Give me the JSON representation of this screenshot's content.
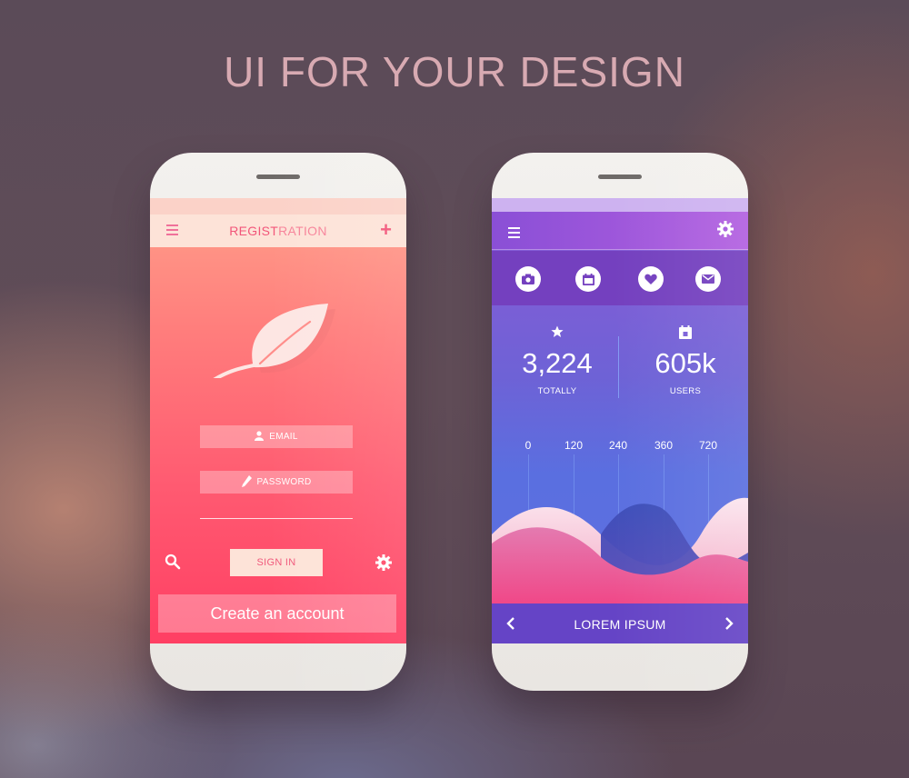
{
  "headline": "UI FOR YOUR DESIGN",
  "colors": {
    "left_accent": "#f2567a",
    "left_gradient_top": "#ff9f8a",
    "left_gradient_bottom": "#ff3f63",
    "right_header": "#8a4fd6",
    "right_footer": "#6544c6"
  },
  "left_phone": {
    "header": {
      "title_highlight": "REGIST",
      "title_rest": "RATION",
      "menu_icon": "hamburger-icon",
      "add_icon": "plus-icon",
      "add_label": "+"
    },
    "logo_icon": "leaf-icon",
    "email_label": "EMAIL",
    "password_label": "PASSWORD",
    "sign_in_label": "SIGN IN",
    "create_account_label": "Create an account",
    "search_icon": "search-icon",
    "settings_icon": "gear-icon"
  },
  "right_phone": {
    "header": {
      "menu_icon": "hamburger-icon",
      "settings_icon": "gear-icon"
    },
    "icon_row": [
      "camera-icon",
      "calendar-icon",
      "heart-icon",
      "mail-icon"
    ],
    "stats": [
      {
        "icon": "star-icon",
        "value": "3,224",
        "label": "TOTALLY"
      },
      {
        "icon": "calendar-icon",
        "value": "605k",
        "label": "USERS"
      }
    ],
    "axis_ticks": [
      "0",
      "120",
      "240",
      "360",
      "720"
    ],
    "footer": {
      "label": "LOREM IPSUM",
      "prev_icon": "chevron-left-icon",
      "next_icon": "chevron-right-icon"
    }
  }
}
